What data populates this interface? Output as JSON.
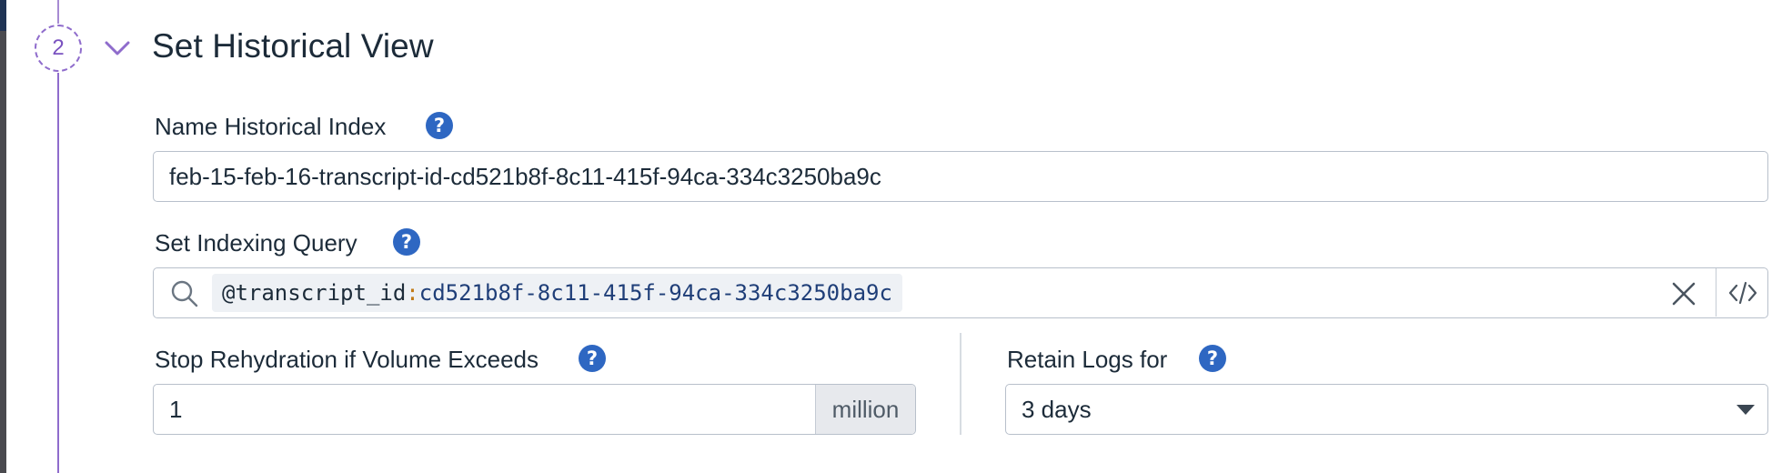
{
  "section": {
    "step_number": "2",
    "title": "Set Historical View"
  },
  "name_index": {
    "label": "Name Historical Index",
    "value": "feb-15-feb-16-transcript-id-cd521b8f-8c11-415f-94ca-334c3250ba9c"
  },
  "indexing_query": {
    "label": "Set Indexing Query",
    "chip_key": "@transcript_id",
    "chip_separator": ":",
    "chip_value": "cd521b8f-8c11-415f-94ca-334c3250ba9c"
  },
  "volume": {
    "label": "Stop Rehydration if Volume Exceeds",
    "value": "1",
    "unit": "million"
  },
  "retention": {
    "label": "Retain Logs for",
    "selected": "3 days"
  },
  "icons": {
    "help": "?",
    "help_color": "#2e67c2",
    "accent_color": "#8f6ccc"
  }
}
